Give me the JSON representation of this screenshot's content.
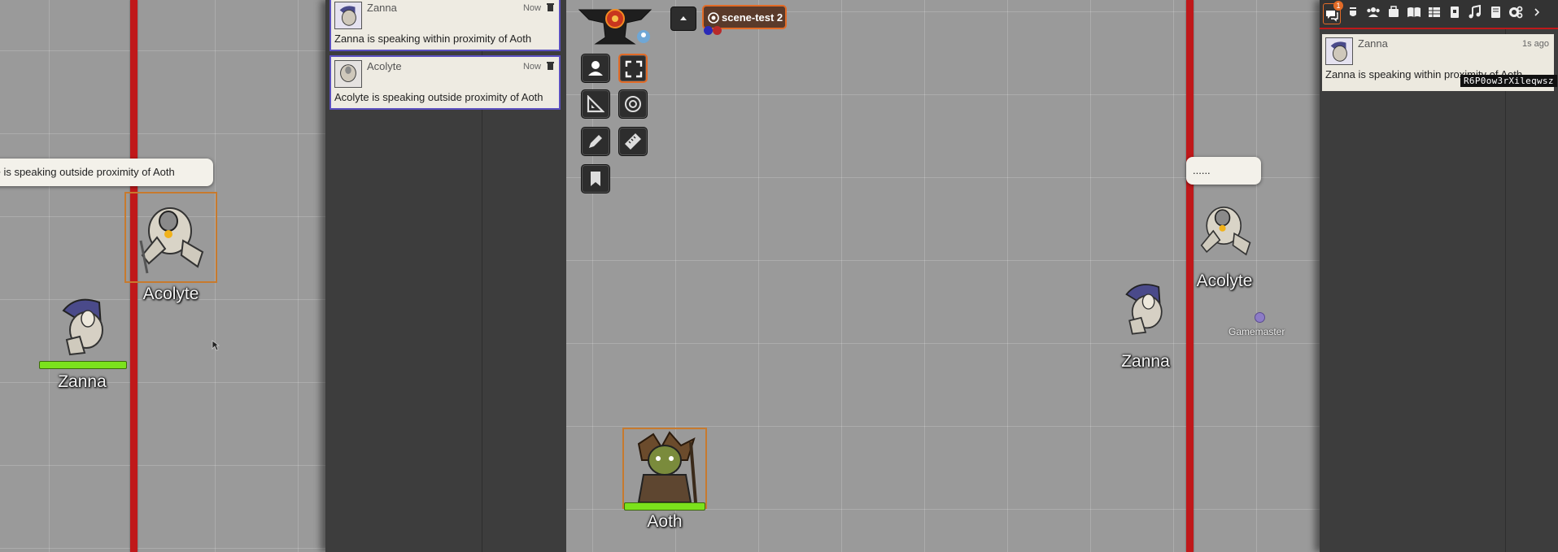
{
  "left_view": {
    "bubble_text": "te is speaking outside proximity of Aoth",
    "tokens": [
      {
        "name": "Acolyte",
        "hp": null
      },
      {
        "name": "Zanna",
        "hp": 1
      }
    ]
  },
  "left_chat": {
    "messages": [
      {
        "speaker": "Zanna",
        "time": "Now",
        "text": "Zanna is speaking within proximity of Aoth"
      },
      {
        "speaker": "Acolyte",
        "time": "Now",
        "text": "Acolyte is speaking outside proximity of Aoth"
      }
    ]
  },
  "center_view": {
    "scene_label": "scene-test 2",
    "token": {
      "name": "Aoth",
      "hp": 1
    }
  },
  "right_view": {
    "bubble_text": "......",
    "tokens": [
      {
        "name": "Acolyte"
      },
      {
        "name": "Zanna"
      }
    ],
    "user_label": "Gamemaster"
  },
  "right_sidebar": {
    "notification_count": "1",
    "tabs": [
      "chat-icon",
      "combat-icon",
      "actors-icon",
      "items-icon",
      "journal-icon",
      "tables-icon",
      "cards-icon",
      "playlists-icon",
      "compendium-icon",
      "settings-icon",
      "collapse-icon"
    ],
    "message": {
      "speaker": "Zanna",
      "time": "1s ago",
      "text": "Zanna is speaking within proximity of Aoth"
    },
    "id_tooltip": "R6P0ow3rXileqwsz"
  },
  "colors": {
    "accent": "#e26b27",
    "wall": "#c0181a",
    "card_border": "#5a4fbf",
    "hp": "#7be21c"
  }
}
